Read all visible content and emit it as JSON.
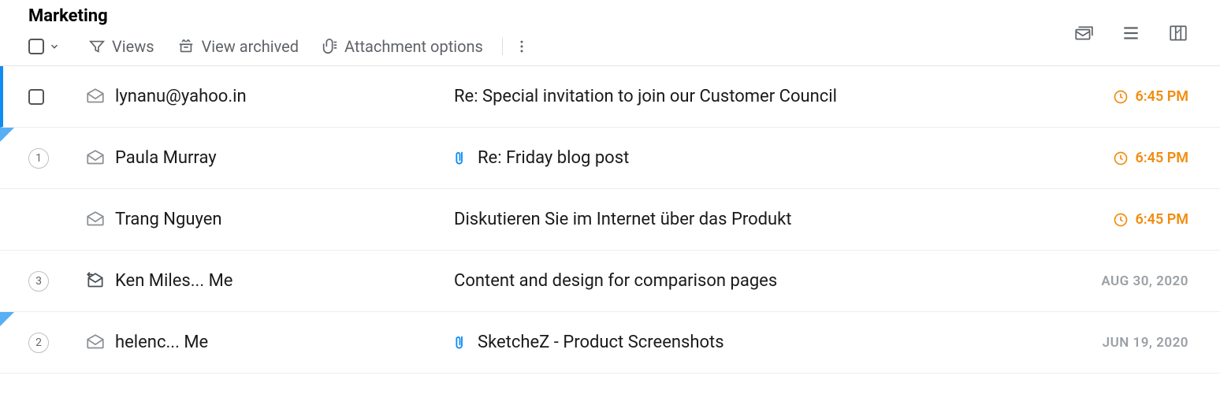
{
  "header": {
    "folder_title": "Marketing"
  },
  "toolbar": {
    "views_label": "Views",
    "archived_label": "View archived",
    "attachment_label": "Attachment options"
  },
  "emails": [
    {
      "sender": "lynanu@yahoo.in",
      "subject": "Re: Special invitation to join our Customer Council",
      "time": "6:45 PM",
      "snoozed": true,
      "attachment": false,
      "thread_count": null,
      "selected": true,
      "flagged": false,
      "reply_icon": false
    },
    {
      "sender": "Paula Murray",
      "subject": "Re: Friday blog post",
      "time": "6:45 PM",
      "snoozed": true,
      "attachment": true,
      "thread_count": "1",
      "selected": false,
      "flagged": true,
      "reply_icon": false
    },
    {
      "sender": "Trang Nguyen",
      "subject": "Diskutieren Sie im Internet über das Produkt",
      "time": "6:45 PM",
      "snoozed": true,
      "attachment": false,
      "thread_count": null,
      "selected": false,
      "flagged": false,
      "reply_icon": false
    },
    {
      "sender": "Ken Miles... Me",
      "subject": "Content and design for comparison pages",
      "time": "AUG 30, 2020",
      "snoozed": false,
      "attachment": false,
      "thread_count": "3",
      "selected": false,
      "flagged": false,
      "reply_icon": true
    },
    {
      "sender": "helenc... Me",
      "subject": "SketcheZ - Product Screenshots",
      "time": "JUN 19, 2020",
      "snoozed": false,
      "attachment": true,
      "thread_count": "2",
      "selected": false,
      "flagged": true,
      "reply_icon": false
    }
  ]
}
